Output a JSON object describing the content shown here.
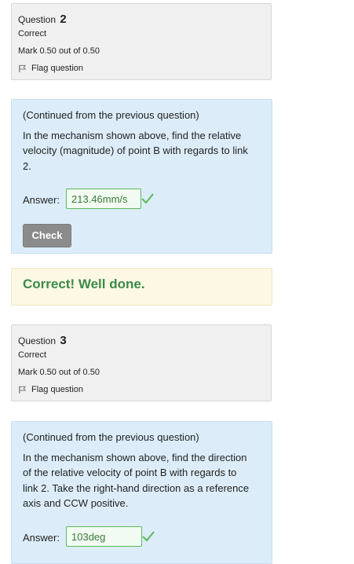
{
  "question2": {
    "label": "Question",
    "number": "2",
    "status": "Correct",
    "mark": "Mark 0.50 out of 0.50",
    "flag_label": "Flag question",
    "paragraph1": "(Continued from the previous question)",
    "paragraph2": "In the mechanism shown above, find the relative velocity (magnitude) of point B with regards to link 2.",
    "answer_label": "Answer:",
    "answer_value": "213.46mm/s",
    "check_label": "Check",
    "feedback": "Correct! Well done."
  },
  "question3": {
    "label": "Question",
    "number": "3",
    "status": "Correct",
    "mark": "Mark 0.50 out of 0.50",
    "flag_label": "Flag question",
    "paragraph1": "(Continued from the previous question)",
    "paragraph2": "In the mechanism shown above, find the direction of the relative velocity of point B with regards to link 2. Take the right-hand direction as a reference axis and CCW positive.",
    "answer_label": "Answer:",
    "answer_value": "103deg"
  },
  "colors": {
    "correct_green": "#5cb85c",
    "feedback_text": "#3c8a4a",
    "formulation_bg": "#dcedf9",
    "info_bg": "#f0f0f0"
  },
  "icons": [
    "flag-icon",
    "checkmark-icon"
  ]
}
